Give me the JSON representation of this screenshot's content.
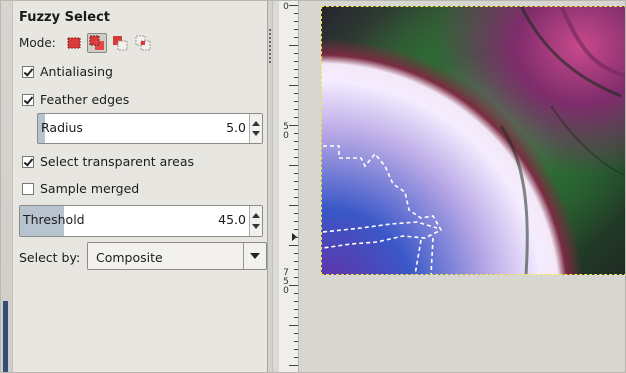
{
  "tool": {
    "title": "Fuzzy Select",
    "mode_label": "Mode:",
    "modes": [
      {
        "icon": "replace-selection-icon",
        "active": false
      },
      {
        "icon": "add-to-selection-icon",
        "active": true
      },
      {
        "icon": "subtract-from-selection-icon",
        "active": false
      },
      {
        "icon": "intersect-selection-icon",
        "active": false
      }
    ]
  },
  "options": {
    "antialiasing": {
      "label": "Antialiasing",
      "checked": true
    },
    "feather_edges": {
      "label": "Feather edges",
      "checked": true
    },
    "radius": {
      "label": "Radius",
      "value": "5.0",
      "fill_fraction": 0.03
    },
    "select_transparent": {
      "label": "Select transparent areas",
      "checked": true
    },
    "sample_merged": {
      "label": "Sample merged",
      "checked": false
    },
    "threshold": {
      "label": "Threshold",
      "value": "45.0",
      "fill_fraction": 0.18
    },
    "select_by": {
      "label": "Select by:",
      "value": "Composite"
    }
  },
  "ruler": {
    "labels": [
      "0",
      "5 0",
      "7 5 0"
    ]
  },
  "colors": {
    "panel": "#e8e6e1",
    "accent_fill": "#b7c3cf",
    "mode_red": "#d93b3b",
    "selection_border": "#f1e44a"
  }
}
